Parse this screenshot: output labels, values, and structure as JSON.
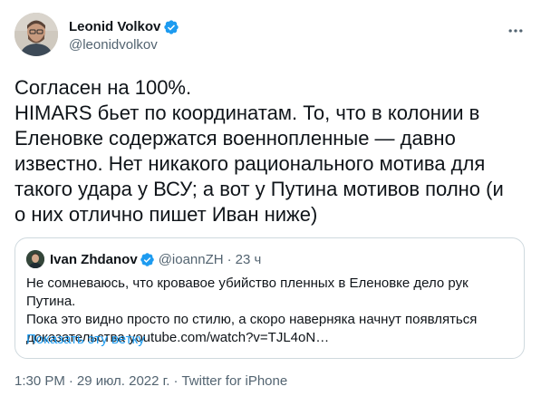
{
  "author": {
    "display_name": "Leonid Volkov",
    "handle": "@leonidvolkov",
    "verified_icon": "verified-badge-icon",
    "avatar_icon": "avatar-photo"
  },
  "more_icon": "more-options-icon",
  "tweet_lines": [
    "Согласен на 100%.",
    "HIMARS бьет по координатам. То, что в колонии в",
    "Еленовке содержатся военнопленные — давно",
    "известно. Нет никакого рационального мотива для",
    "такого удара у ВСУ; а вот у Путина мотивов полно (и",
    "о них отлично пишет Иван ниже)"
  ],
  "quote": {
    "display_name": "Ivan Zhdanov",
    "handle": "@ioannZH",
    "separator": "·",
    "time": "23 ч",
    "body_lines": [
      "Не сомневаюсь, что кровавое убийство пленных в Еленовке дело рук Путина.",
      "Пока это видно просто по стилю, а скоро наверняка начнут появляться",
      "доказательства youtube.com/watch?v=TJL4oN…"
    ],
    "show_thread": "Показать эту ветку"
  },
  "meta": {
    "time": "1:30 PM",
    "separator": "·",
    "date": "29 июл. 2022 г.",
    "source": "Twitter for iPhone"
  },
  "colors": {
    "text": "#0f1419",
    "secondary": "#536471",
    "link": "#1d9bf0",
    "verified": "#1d9bf0",
    "border": "#cfd9de"
  }
}
